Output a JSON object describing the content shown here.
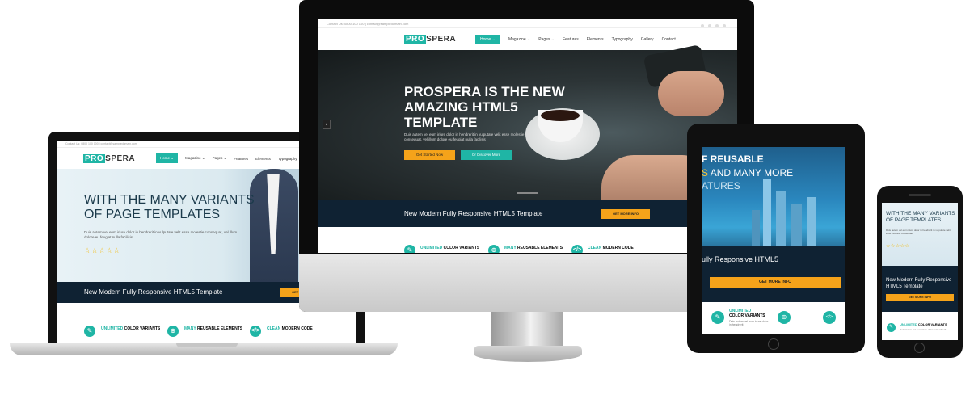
{
  "site": {
    "logo_pro": "PRO",
    "logo_rest": "SPERA",
    "contact": "Contact Us: 0800 100 100  |  contact@sampledomain.com",
    "nav": [
      "Home",
      "Magazine",
      "Pages",
      "Features",
      "Elements",
      "Typography",
      "Gallery",
      "Contact"
    ],
    "features": [
      "UNLIMITED COLOR VARIANTS",
      "MANY REUSABLE ELEMENTS",
      "CLEAN MODERN CODE"
    ],
    "features_split": [
      {
        "accent": "UNLIMITED",
        "rest": " COLOR VARIANTS"
      },
      {
        "accent": "MANY",
        "rest": " REUSABLE ELEMENTS"
      },
      {
        "accent": "CLEAN",
        "rest": " MODERN CODE"
      }
    ],
    "feature_body": "Duis autem vel eum iriure dolor in hendrerit",
    "band_text": "New Modern Fully Responsive HTML5 Template",
    "band_button": "GET MORE INFO"
  },
  "monitor": {
    "hero_title": "PROSPERA IS THE NEW AMAZING HTML5 TEMPLATE",
    "hero_body": "Duis autem vel eum iriure dolor in hendrerit in vulputate velit esse molestie consequat, vel illum dolore eu feugiat nulla facilisis",
    "btn_primary": "Get Started Now",
    "btn_secondary": "Or Discover More",
    "slider_arrow": "‹"
  },
  "laptop": {
    "hero_title": "WITH THE MANY VARIANTS OF PAGE TEMPLATES",
    "hero_body": "Duis autem vel eum iriure dolor in hendrerit in vulputate velit esse molestie consequat, vel illum dolore eu feugiat nulla facilisis",
    "stars": "☆☆☆☆☆"
  },
  "tablet": {
    "hero_line1": "F REUSABLE",
    "hero_line2_accent": "S",
    "hero_line2_rest": " AND MANY MORE",
    "hero_line3": "ATURES",
    "band_text": "ully Responsive HTML5",
    "feature1": "UNLIMITED COLOR VARIANTS",
    "feature1_accent": "UNLIMITED",
    "feature1_rest": "COLOR VARIANTS"
  },
  "phone": {
    "hero_title": "WITH THE MANY VARIANTS OF PAGE TEMPLATES",
    "hero_body": "Duis autem vel eum iriure dolor in hendrerit in vulputate velit esse molestie consequat",
    "band_text": "New Modern Fully Responsive HTML5 Template",
    "feature_accent": "UNLIMITED",
    "feature_rest": "COLOR VARIANTS"
  },
  "colors": {
    "accent": "#1fb5a5",
    "button": "#f5a31a",
    "band": "#0f2233"
  },
  "icons": [
    "droplet-icon",
    "crosshair-icon",
    "code-icon",
    "star-icon",
    "chevron-down-icon",
    "chevron-left-icon"
  ]
}
